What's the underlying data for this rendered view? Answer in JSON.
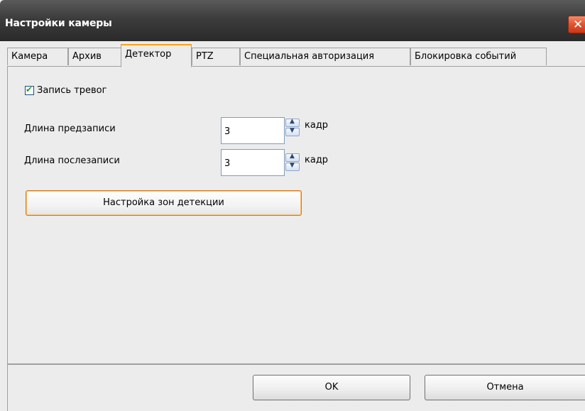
{
  "window": {
    "title": "Настройки камеры",
    "close_glyph": "✕"
  },
  "tabs": [
    {
      "label": "Камера",
      "active": false
    },
    {
      "label": "Архив",
      "active": false
    },
    {
      "label": "Детектор",
      "active": true
    },
    {
      "label": "PTZ",
      "active": false
    },
    {
      "label": "Специальная авторизация",
      "active": false
    },
    {
      "label": "Блокировка событий",
      "active": false
    }
  ],
  "detector": {
    "alarm_recording": {
      "label": "Запись тревог",
      "checked": true
    },
    "prerecord": {
      "label": "Длина предзаписи",
      "value": "3",
      "unit": "кадр"
    },
    "postrecord": {
      "label": "Длина послезаписи",
      "value": "3",
      "unit": "кадр"
    },
    "zones_button": "Настройка зон детекции"
  },
  "footer": {
    "ok_label": "OK",
    "cancel_label": "Отмена"
  },
  "colors": {
    "active_tab_accent": "#f7a21c",
    "close_button": "#e0532f",
    "titlebar": "#3c3c3c"
  }
}
